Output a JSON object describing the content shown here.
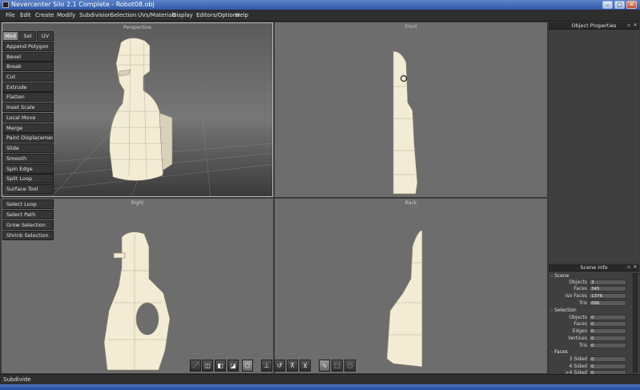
{
  "window": {
    "title": "Nevercenter Silo 2.1 Complete - Robot08.obj",
    "minimize_glyph": "–",
    "maximize_glyph": "□",
    "close_glyph": "✕"
  },
  "menu": [
    "File",
    "Edit",
    "Create",
    "Modify",
    "Subdivision",
    "Selection",
    "UVs/Materials",
    "Display",
    "Editors/Options",
    "Help"
  ],
  "viewports": {
    "perspective": "Perspective",
    "front": "Front",
    "right": "Right",
    "back": "Back"
  },
  "mode_tabs": [
    "Mod",
    "Sel",
    "UV"
  ],
  "active_mode": "Mod",
  "modify_tools": [
    "Append Polygon",
    "Bevel",
    "Break",
    "Cut",
    "Extrude",
    "Flatten",
    "Inset Scale",
    "Local Move",
    "Merge",
    "Paint Displacement",
    "Slide",
    "Smooth",
    "Spin Edge",
    "Split Loop",
    "Surface Tool"
  ],
  "selection_tools": [
    "Select Loop",
    "Select Path",
    "Grow Selection",
    "Shrink Selection"
  ],
  "object_properties": {
    "title": "Object Properties",
    "close_glyph": "✕",
    "float_glyph": "▫"
  },
  "scene_info": {
    "title": "Scene Info",
    "close_glyph": "✕",
    "float_glyph": "▫",
    "scene": {
      "header": "- Scene",
      "rows": [
        {
          "label": "Objects",
          "value": "3"
        },
        {
          "label": "Faces",
          "value": "345"
        },
        {
          "label": "Iso Faces",
          "value": "1376"
        },
        {
          "label": "Tris",
          "value": "686"
        }
      ]
    },
    "selection": {
      "header": "- Selection",
      "rows": [
        {
          "label": "Objects",
          "value": "0"
        },
        {
          "label": "Faces",
          "value": "0"
        },
        {
          "label": "Edges",
          "value": "0"
        },
        {
          "label": "Vertices",
          "value": "0"
        },
        {
          "label": "Tris",
          "value": "0"
        }
      ]
    },
    "faces": {
      "header": "- Faces",
      "rows": [
        {
          "label": "3 Sided",
          "value": "0"
        },
        {
          "label": "4 Sided",
          "value": "0"
        },
        {
          "label": ">4 Sided",
          "value": "0"
        }
      ]
    }
  },
  "bottom_toolbar": [
    {
      "name": "vertex-mode-icon",
      "glyph": "⋰"
    },
    {
      "name": "edge-mode-icon",
      "glyph": "◫"
    },
    {
      "name": "face-mode-icon",
      "glyph": "◧"
    },
    {
      "name": "object-mode-icon",
      "glyph": "◪"
    },
    {
      "name": "object-select-icon",
      "glyph": "⬡"
    },
    {
      "name": "move-manipulator-icon",
      "glyph": "⊥"
    },
    {
      "name": "rotate-manipulator-icon",
      "glyph": "↺"
    },
    {
      "name": "scale-manipulator-icon",
      "glyph": "⊼"
    },
    {
      "name": "universal-manipulator-icon",
      "glyph": "⊻"
    },
    {
      "name": "lasso-select-icon",
      "glyph": "∿"
    },
    {
      "name": "box-select-icon",
      "glyph": "⬚"
    },
    {
      "name": "paint-select-icon",
      "glyph": "◌"
    }
  ],
  "status": "Subdivide",
  "colors": {
    "mesh_fill": "#f3ecd4",
    "mesh_line": "#8c8472",
    "viewport_bg": "#6d6d6d",
    "panel_bg": "#3f3f3f",
    "titlebar": "#2f5aaa"
  }
}
